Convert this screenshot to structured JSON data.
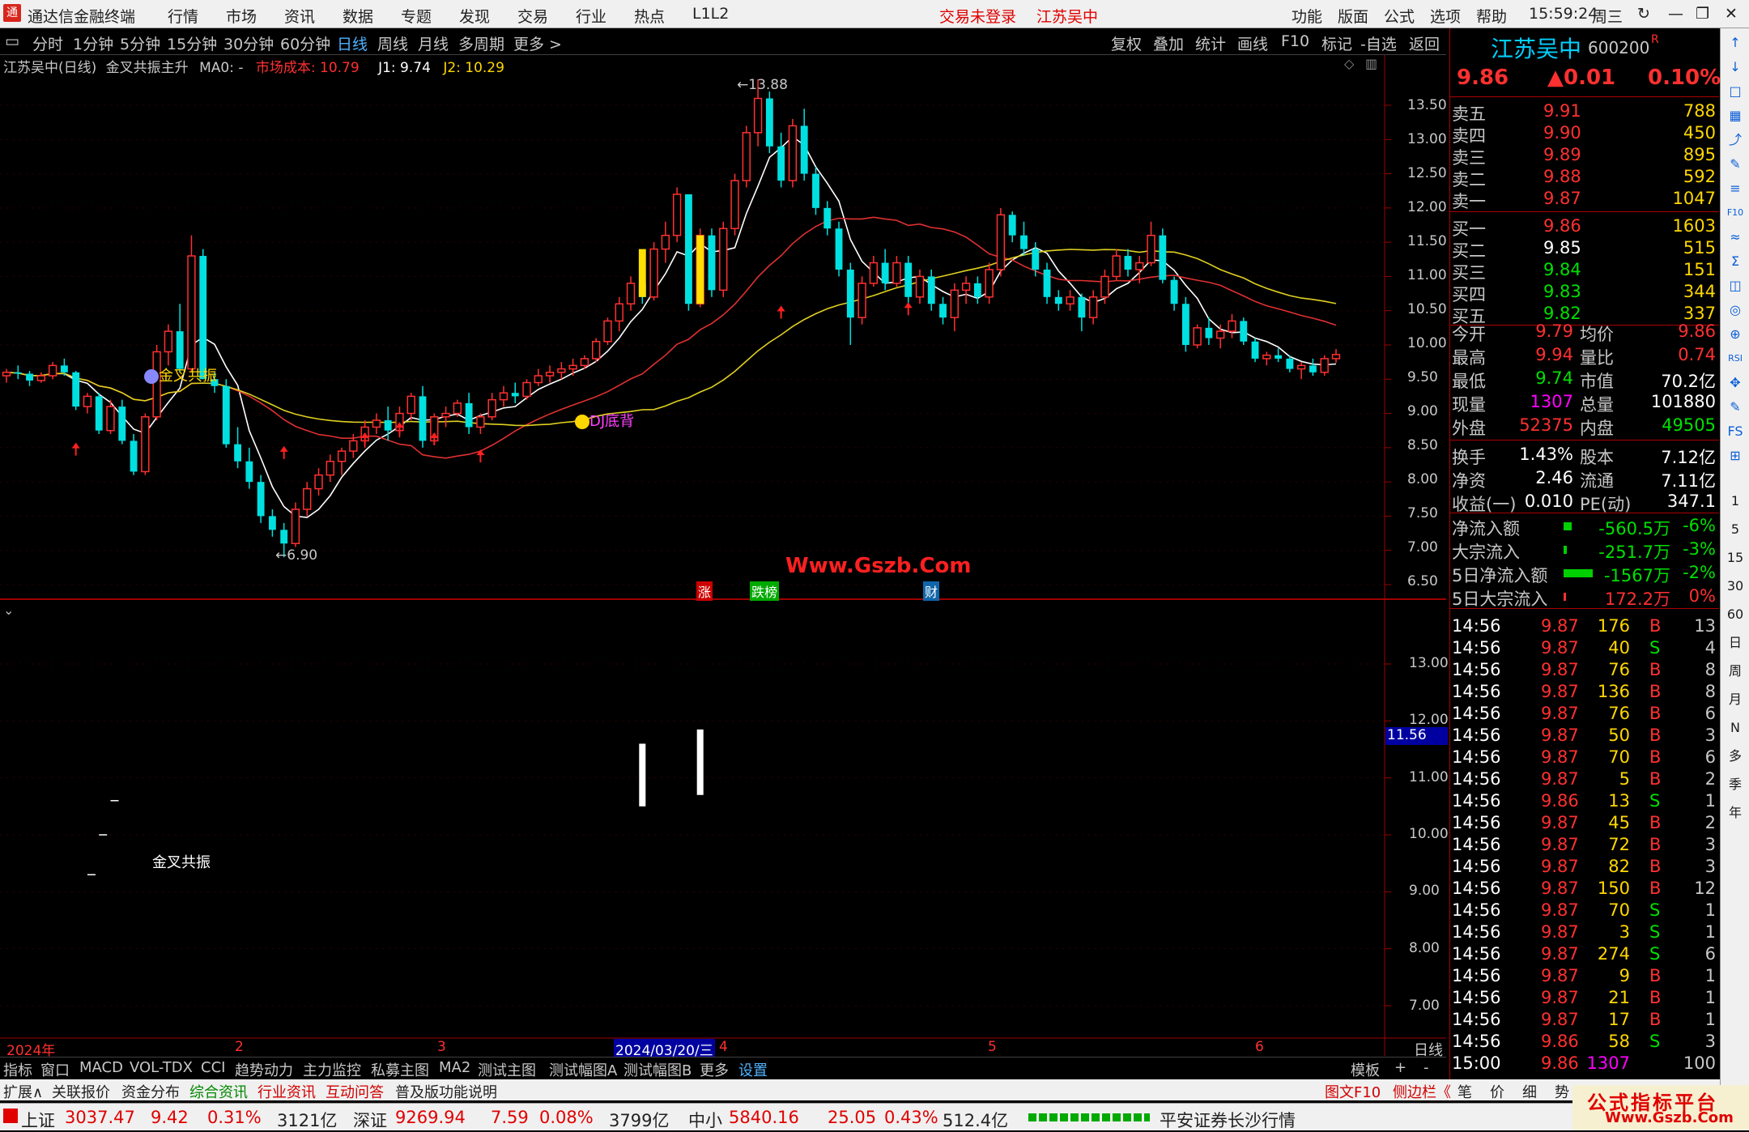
{
  "menubar": {
    "app_title": "通达信金融终端",
    "menus": [
      "行情",
      "市场",
      "资讯",
      "数据",
      "专题",
      "发现",
      "交易",
      "行业",
      "热点",
      "L1L2"
    ],
    "trade_status": "交易未登录",
    "stock_name": "江苏吴中",
    "right_menus": [
      "功能",
      "版面",
      "公式",
      "选项",
      "帮助"
    ],
    "time": "15:59:24",
    "weekday": "周三"
  },
  "toolbar": {
    "periods": [
      "分时",
      "1分钟",
      "5分钟",
      "15分钟",
      "30分钟",
      "60分钟",
      "日线",
      "周线",
      "月线",
      "多周期",
      "更多 >"
    ],
    "active": "日线",
    "right_tools": [
      "复权",
      "叠加",
      "统计",
      "画线",
      "F10",
      "标记",
      "-自选",
      "返回"
    ]
  },
  "main_chart": {
    "title_stock": "江苏吴中(日线)",
    "title_formula": "金叉共振主升",
    "ma0_label": "MA0: -",
    "cost_label": "市场成本: 10.79",
    "j1_label": "J1: 9.74",
    "j2_label": "J2: 10.29",
    "high_label": "13.88",
    "low_label": "6.90",
    "signal1": "金叉共振",
    "signal2": "DJ底背",
    "watermark": "Www.Gszb.Com",
    "badge_zhang": "涨",
    "badge_diebang": "跌榜",
    "badge_cai": "财",
    "y_ticks": [
      "13.50",
      "13.00",
      "12.50",
      "12.00",
      "11.50",
      "11.00",
      "10.50",
      "10.00",
      "9.50",
      "9.00",
      "8.50",
      "8.00",
      "7.50",
      "7.00",
      "6.50"
    ]
  },
  "lower_chart": {
    "signal_label": "金叉共振",
    "current_value": "11.56",
    "y_ticks": [
      "13.00",
      "12.00",
      "11.00",
      "10.00",
      "9.00",
      "8.00",
      "7.00"
    ]
  },
  "x_axis": {
    "labels": [
      "2024年",
      "2",
      "3",
      "2024/03/20/三",
      "4",
      "5",
      "6"
    ],
    "right_label": "日线"
  },
  "quote": {
    "name": "江苏吴中",
    "code": "600200",
    "code_suffix": "R",
    "price": "9.86",
    "change": "▲0.01",
    "change_pct": "0.10%",
    "asks": [
      {
        "label": "卖五",
        "price": "9.91",
        "vol": "788"
      },
      {
        "label": "卖四",
        "price": "9.90",
        "vol": "450"
      },
      {
        "label": "卖三",
        "price": "9.89",
        "vol": "895"
      },
      {
        "label": "卖二",
        "price": "9.88",
        "vol": "592"
      },
      {
        "label": "卖一",
        "price": "9.87",
        "vol": "1047"
      }
    ],
    "bids": [
      {
        "label": "买一",
        "price": "9.86",
        "vol": "1603"
      },
      {
        "label": "买二",
        "price": "9.85",
        "vol": "515"
      },
      {
        "label": "买三",
        "price": "9.84",
        "vol": "151"
      },
      {
        "label": "买四",
        "price": "9.83",
        "vol": "344"
      },
      {
        "label": "买五",
        "price": "9.82",
        "vol": "337"
      }
    ],
    "stats": [
      {
        "k1": "今开",
        "v1": "9.79",
        "k2": "均价",
        "v2": "9.86"
      },
      {
        "k1": "最高",
        "v1": "9.94",
        "k2": "量比",
        "v2": "0.74"
      },
      {
        "k1": "最低",
        "v1": "9.74",
        "k2": "市值",
        "v2": "70.2亿"
      },
      {
        "k1": "现量",
        "v1": "1307",
        "k2": "总量",
        "v2": "101880"
      },
      {
        "k1": "外盘",
        "v1": "52375",
        "k2": "内盘",
        "v2": "49505"
      }
    ],
    "stats2": [
      {
        "k1": "换手",
        "v1": "1.43%",
        "k2": "股本",
        "v2": "7.12亿"
      },
      {
        "k1": "净资",
        "v1": "2.46",
        "k2": "流通",
        "v2": "7.11亿"
      },
      {
        "k1": "收益(一)",
        "v1": "0.010",
        "k2": "PE(动)",
        "v2": "347.1"
      }
    ],
    "flows": [
      {
        "label": "净流入额",
        "value": "-560.5万",
        "pct": "-6%"
      },
      {
        "label": "大宗流入",
        "value": "-251.7万",
        "pct": "-3%"
      },
      {
        "label": "5日净流入额",
        "value": "-1567万",
        "pct": "-2%"
      },
      {
        "label": "5日大宗流入",
        "value": "172.2万",
        "pct": "0%"
      }
    ],
    "ticks": [
      {
        "t": "14:56",
        "p": "9.87",
        "v": "176",
        "s": "B",
        "n": "13"
      },
      {
        "t": "14:56",
        "p": "9.87",
        "v": "40",
        "s": "S",
        "n": "4"
      },
      {
        "t": "14:56",
        "p": "9.87",
        "v": "76",
        "s": "B",
        "n": "8"
      },
      {
        "t": "14:56",
        "p": "9.87",
        "v": "136",
        "s": "B",
        "n": "8"
      },
      {
        "t": "14:56",
        "p": "9.87",
        "v": "76",
        "s": "B",
        "n": "6"
      },
      {
        "t": "14:56",
        "p": "9.87",
        "v": "50",
        "s": "B",
        "n": "3"
      },
      {
        "t": "14:56",
        "p": "9.87",
        "v": "70",
        "s": "B",
        "n": "6"
      },
      {
        "t": "14:56",
        "p": "9.87",
        "v": "5",
        "s": "B",
        "n": "2"
      },
      {
        "t": "14:56",
        "p": "9.86",
        "v": "13",
        "s": "S",
        "n": "1"
      },
      {
        "t": "14:56",
        "p": "9.87",
        "v": "45",
        "s": "B",
        "n": "2"
      },
      {
        "t": "14:56",
        "p": "9.87",
        "v": "72",
        "s": "B",
        "n": "3"
      },
      {
        "t": "14:56",
        "p": "9.87",
        "v": "82",
        "s": "B",
        "n": "3"
      },
      {
        "t": "14:56",
        "p": "9.87",
        "v": "150",
        "s": "B",
        "n": "12"
      },
      {
        "t": "14:56",
        "p": "9.87",
        "v": "70",
        "s": "S",
        "n": "1"
      },
      {
        "t": "14:56",
        "p": "9.87",
        "v": "3",
        "s": "S",
        "n": "1"
      },
      {
        "t": "14:56",
        "p": "9.87",
        "v": "274",
        "s": "S",
        "n": "6"
      },
      {
        "t": "14:56",
        "p": "9.87",
        "v": "9",
        "s": "B",
        "n": "1"
      },
      {
        "t": "14:56",
        "p": "9.87",
        "v": "21",
        "s": "B",
        "n": "1"
      },
      {
        "t": "14:56",
        "p": "9.87",
        "v": "17",
        "s": "B",
        "n": "1"
      },
      {
        "t": "14:56",
        "p": "9.86",
        "v": "58",
        "s": "S",
        "n": "3"
      },
      {
        "t": "15:00",
        "p": "9.86",
        "v": "1307",
        "s": "",
        "n": "100"
      }
    ]
  },
  "toolcol": [
    "↑",
    "↓",
    "□",
    "▦",
    "⤴",
    "✎",
    "≡",
    "F10",
    "≈",
    "Σ",
    "◫",
    "◎",
    "⊕",
    "RSI",
    "✥",
    "✎",
    "FS",
    "⊞",
    "1",
    "5",
    "15",
    "30",
    "60",
    "日",
    "周",
    "月",
    "N",
    "多",
    "季",
    "年"
  ],
  "tabs1": [
    "指标",
    "窗口",
    "MACD",
    "VOL-TDX",
    "CCI",
    "趋势动力",
    "主力监控",
    "私募主图",
    "MA2",
    "测试主图",
    "测试幅图A",
    "测试幅图B",
    "更多",
    "设置"
  ],
  "tabs1_right": [
    "模板",
    "+",
    "-"
  ],
  "tabs2": [
    "扩展∧",
    "关联报价",
    "资金分布",
    "综合资讯",
    "行业资讯",
    "互动问答",
    "普及版功能说明"
  ],
  "tabs2_right": [
    "图文F10",
    "侧边栏《",
    "笔",
    "价",
    "细",
    "势"
  ],
  "status": {
    "sh_label": "上证",
    "sh_value": "3037.47",
    "sh_change": "9.42",
    "sh_pct": "0.31%",
    "sh_amount": "3121亿",
    "sz_label": "深证",
    "sz_value": "9269.94",
    "sz_change": "7.59",
    "sz_pct": "0.08%",
    "sz_amount": "3799亿",
    "zx_label": "中小",
    "zx_value": "5840.16",
    "zx_change": "25.05",
    "zx_pct": "0.43%",
    "zx_amount": "512.4亿",
    "broker": "平安证券长沙行情",
    "brand": "公式指标平台",
    "brand_url": "Www.Gszb.Com"
  },
  "colors": {
    "up": "#ff3030",
    "down": "#00e0e0",
    "ma_short": "#ffffff",
    "ma_mid": "#e03030",
    "ma_long": "#e0d020",
    "signal_bar": "#ffe000",
    "arrow": "#ff2020"
  },
  "chart_data": {
    "type": "candlestick",
    "price_ylim": [
      6.5,
      13.8
    ],
    "candles": [
      [
        9.55,
        9.65,
        9.45,
        9.6
      ],
      [
        9.6,
        9.7,
        9.5,
        9.58
      ],
      [
        9.58,
        9.62,
        9.4,
        9.48
      ],
      [
        9.48,
        9.6,
        9.45,
        9.55
      ],
      [
        9.55,
        9.75,
        9.5,
        9.7
      ],
      [
        9.7,
        9.8,
        9.55,
        9.6
      ],
      [
        9.6,
        9.62,
        9.05,
        9.1
      ],
      [
        9.1,
        9.3,
        9.0,
        9.25
      ],
      [
        9.25,
        9.3,
        8.7,
        8.75
      ],
      [
        8.75,
        9.2,
        8.7,
        9.1
      ],
      [
        9.1,
        9.2,
        8.55,
        8.6
      ],
      [
        8.6,
        8.7,
        8.1,
        8.15
      ],
      [
        8.15,
        9.0,
        8.1,
        8.95
      ],
      [
        8.95,
        10.0,
        8.9,
        9.9
      ],
      [
        9.9,
        10.3,
        9.7,
        10.2
      ],
      [
        10.2,
        10.6,
        9.6,
        9.65
      ],
      [
        9.65,
        11.6,
        9.6,
        11.3
      ],
      [
        11.3,
        11.4,
        9.5,
        9.5
      ],
      [
        9.5,
        9.6,
        9.3,
        9.4
      ],
      [
        9.4,
        9.5,
        8.5,
        8.55
      ],
      [
        8.55,
        8.8,
        8.2,
        8.3
      ],
      [
        8.3,
        8.5,
        7.9,
        8.0
      ],
      [
        8.0,
        8.1,
        7.4,
        7.5
      ],
      [
        7.5,
        7.6,
        7.2,
        7.3
      ],
      [
        7.3,
        7.4,
        6.9,
        7.1
      ],
      [
        7.1,
        7.7,
        7.05,
        7.6
      ],
      [
        7.6,
        8.0,
        7.5,
        7.9
      ],
      [
        7.9,
        8.2,
        7.8,
        8.1
      ],
      [
        8.1,
        8.4,
        8.0,
        8.3
      ],
      [
        8.3,
        8.5,
        8.1,
        8.45
      ],
      [
        8.45,
        8.7,
        8.35,
        8.6
      ],
      [
        8.6,
        8.9,
        8.5,
        8.8
      ],
      [
        8.8,
        9.0,
        8.7,
        8.9
      ],
      [
        8.9,
        9.1,
        8.6,
        8.75
      ],
      [
        8.75,
        9.1,
        8.65,
        9.0
      ],
      [
        9.0,
        9.3,
        8.9,
        9.25
      ],
      [
        9.25,
        9.4,
        8.5,
        8.6
      ],
      [
        8.6,
        9.0,
        8.55,
        8.95
      ],
      [
        8.95,
        9.1,
        8.8,
        9.0
      ],
      [
        9.0,
        9.2,
        8.95,
        9.15
      ],
      [
        9.15,
        9.3,
        8.7,
        8.8
      ],
      [
        8.8,
        9.0,
        8.7,
        8.95
      ],
      [
        8.95,
        9.3,
        8.9,
        9.2
      ],
      [
        9.2,
        9.4,
        9.1,
        9.3
      ],
      [
        9.3,
        9.45,
        9.15,
        9.25
      ],
      [
        9.25,
        9.5,
        9.2,
        9.45
      ],
      [
        9.45,
        9.65,
        9.4,
        9.55
      ],
      [
        9.55,
        9.7,
        9.45,
        9.6
      ],
      [
        9.6,
        9.75,
        9.5,
        9.65
      ],
      [
        9.65,
        9.8,
        9.55,
        9.7
      ],
      [
        9.7,
        9.85,
        9.65,
        9.8
      ],
      [
        9.8,
        10.1,
        9.75,
        10.05
      ],
      [
        10.05,
        10.4,
        10.0,
        10.35
      ],
      [
        10.35,
        10.7,
        10.2,
        10.6
      ],
      [
        10.6,
        11.0,
        10.5,
        10.9
      ],
      [
        10.9,
        11.2,
        10.6,
        10.7
      ],
      [
        10.7,
        11.5,
        10.65,
        11.4
      ],
      [
        11.4,
        11.8,
        11.2,
        11.6
      ],
      [
        11.6,
        12.3,
        11.5,
        12.2
      ],
      [
        12.2,
        12.0,
        10.5,
        10.6
      ],
      [
        10.6,
        11.7,
        10.55,
        11.6
      ],
      [
        11.6,
        11.7,
        10.7,
        10.8
      ],
      [
        10.8,
        11.8,
        10.7,
        11.7
      ],
      [
        11.7,
        12.5,
        11.6,
        12.4
      ],
      [
        12.4,
        13.2,
        12.3,
        13.1
      ],
      [
        13.1,
        13.88,
        12.9,
        13.6
      ],
      [
        13.6,
        13.7,
        12.8,
        12.9
      ],
      [
        12.9,
        13.1,
        12.3,
        12.4
      ],
      [
        12.4,
        13.3,
        12.3,
        13.2
      ],
      [
        13.2,
        13.45,
        12.4,
        12.5
      ],
      [
        12.5,
        12.6,
        11.9,
        12.0
      ],
      [
        12.0,
        12.1,
        11.6,
        11.7
      ],
      [
        11.7,
        11.8,
        11.0,
        11.1
      ],
      [
        11.1,
        11.2,
        10.0,
        10.4
      ],
      [
        10.4,
        11.0,
        10.3,
        10.9
      ],
      [
        10.9,
        11.3,
        10.85,
        11.2
      ],
      [
        11.2,
        11.4,
        10.8,
        10.9
      ],
      [
        10.9,
        11.3,
        10.85,
        11.2
      ],
      [
        11.2,
        11.3,
        10.6,
        10.7
      ],
      [
        10.7,
        11.1,
        10.6,
        11.0
      ],
      [
        11.0,
        11.1,
        10.5,
        10.6
      ],
      [
        10.6,
        10.7,
        10.3,
        10.4
      ],
      [
        10.4,
        10.9,
        10.2,
        10.8
      ],
      [
        10.8,
        11.0,
        10.6,
        10.9
      ],
      [
        10.9,
        11.0,
        10.6,
        10.7
      ],
      [
        10.7,
        11.2,
        10.6,
        11.1
      ],
      [
        11.1,
        12.0,
        11.0,
        11.9
      ],
      [
        11.9,
        11.95,
        11.5,
        11.6
      ],
      [
        11.6,
        11.8,
        11.3,
        11.4
      ],
      [
        11.4,
        11.5,
        11.0,
        11.1
      ],
      [
        11.1,
        11.2,
        10.6,
        10.7
      ],
      [
        10.7,
        10.8,
        10.5,
        10.6
      ],
      [
        10.6,
        10.8,
        10.5,
        10.7
      ],
      [
        10.7,
        10.75,
        10.2,
        10.4
      ],
      [
        10.4,
        10.8,
        10.3,
        10.7
      ],
      [
        10.7,
        11.1,
        10.6,
        11.0
      ],
      [
        11.0,
        11.4,
        10.95,
        11.3
      ],
      [
        11.3,
        11.4,
        11.0,
        11.1
      ],
      [
        11.1,
        11.3,
        10.9,
        11.2
      ],
      [
        11.2,
        11.8,
        11.15,
        11.6
      ],
      [
        11.6,
        11.7,
        10.9,
        10.95
      ],
      [
        10.95,
        11.0,
        10.5,
        10.6
      ],
      [
        10.6,
        10.7,
        9.9,
        10.0
      ],
      [
        10.0,
        10.3,
        9.95,
        10.25
      ],
      [
        10.25,
        10.4,
        10.0,
        10.1
      ],
      [
        10.1,
        10.3,
        9.95,
        10.2
      ],
      [
        10.2,
        10.45,
        10.1,
        10.35
      ],
      [
        10.35,
        10.4,
        10.0,
        10.05
      ],
      [
        10.05,
        10.1,
        9.75,
        9.8
      ],
      [
        9.8,
        9.9,
        9.7,
        9.85
      ],
      [
        9.85,
        9.95,
        9.75,
        9.8
      ],
      [
        9.8,
        9.85,
        9.6,
        9.65
      ],
      [
        9.65,
        9.75,
        9.5,
        9.7
      ],
      [
        9.7,
        9.8,
        9.55,
        9.6
      ],
      [
        9.6,
        9.85,
        9.55,
        9.8
      ],
      [
        9.8,
        9.94,
        9.74,
        9.86
      ]
    ],
    "signal_bars_lower": [
      [
        11.6,
        10.5
      ],
      [
        11.85,
        10.7
      ]
    ]
  }
}
